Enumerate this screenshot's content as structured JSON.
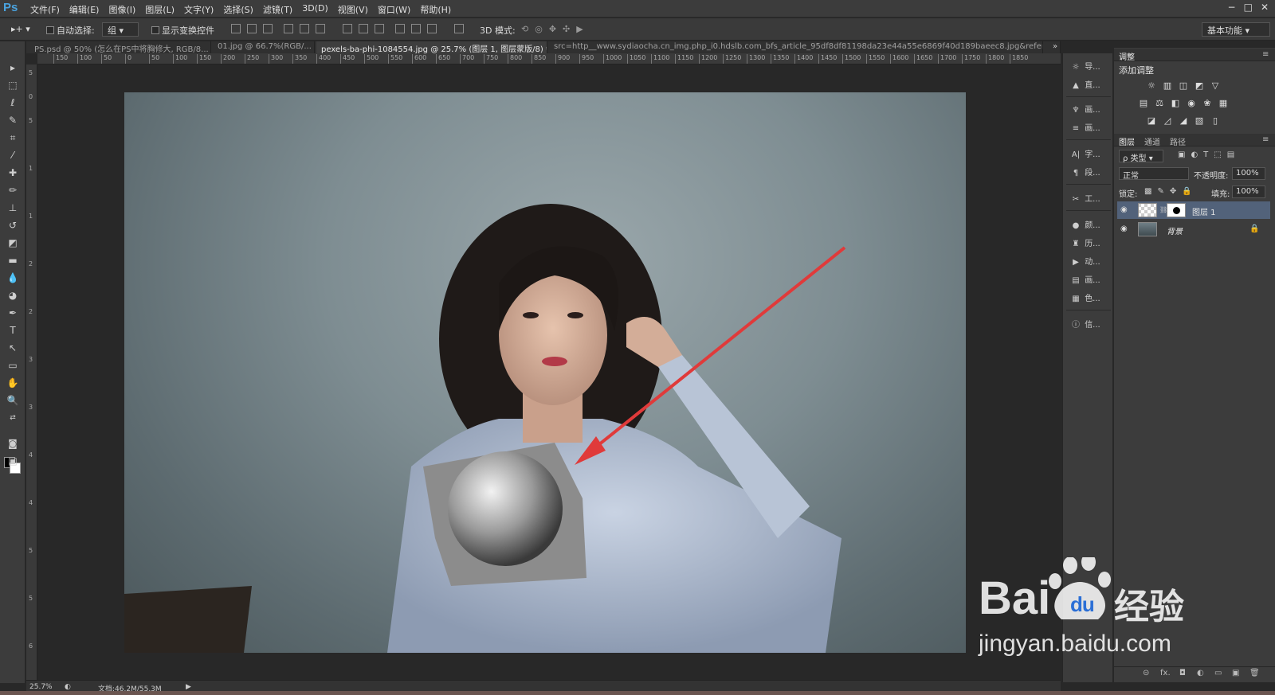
{
  "app": {
    "logo": "Ps",
    "window_controls": [
      "−",
      "□",
      "✕"
    ]
  },
  "menu": [
    "文件(F)",
    "编辑(E)",
    "图像(I)",
    "图层(L)",
    "文字(Y)",
    "选择(S)",
    "滤镜(T)",
    "3D(D)",
    "视图(V)",
    "窗口(W)",
    "帮助(H)"
  ],
  "options": {
    "auto_select_label": "自动选择:",
    "auto_select_value": "组",
    "show_transform_label": "显示变换控件",
    "mode_3d_label": "3D 模式:",
    "workspace": "基本功能"
  },
  "tabs": [
    {
      "label": "PS.psd @ 50% (怎么在PS中将胸修大, RGB/8...",
      "close": "×"
    },
    {
      "label": "01.jpg @ 66.7%(RGB/...",
      "close": "×"
    },
    {
      "label": "pexels-ba-phi-1084554.jpg @ 25.7% (图层 1, 图层蒙版/8) *",
      "close": "×"
    },
    {
      "label": "src=http__www.sydiaocha.cn_img.php_i0.hdslb.com_bfs_article_95df8df81198da23e44a55e6869f40d189baeec8.jpg&refer=http__v"
    }
  ],
  "ruler_h": [
    "150",
    "100",
    "50",
    "0",
    "50",
    "100",
    "150",
    "200",
    "250",
    "300",
    "350",
    "400",
    "450",
    "500",
    "550",
    "600",
    "650",
    "700",
    "750",
    "800",
    "850",
    "900",
    "950",
    "1000",
    "1050",
    "1100",
    "1150",
    "1200",
    "1250",
    "1300",
    "1350",
    "1400",
    "1450",
    "1500",
    "1550",
    "1600",
    "1650",
    "1700",
    "1750",
    "1800",
    "1850"
  ],
  "status": {
    "zoom": "25.7%",
    "doc": "文档:46.2M/55.3M"
  },
  "midcol": [
    {
      "icon": "☼",
      "label": "导..."
    },
    {
      "icon": "▲",
      "label": "直..."
    },
    {
      "icon": "♆",
      "label": "画..."
    },
    {
      "icon": "≡",
      "label": "画..."
    },
    {
      "icon": "A|",
      "label": "字..."
    },
    {
      "icon": "¶",
      "label": "段..."
    },
    {
      "icon": "✂",
      "label": "工..."
    },
    {
      "icon": "●",
      "label": "颜..."
    },
    {
      "icon": "♜",
      "label": "历..."
    },
    {
      "icon": "▶",
      "label": "动..."
    },
    {
      "icon": "▤",
      "label": "画..."
    },
    {
      "icon": "▦",
      "label": "色..."
    },
    {
      "icon": "ⓘ",
      "label": "信..."
    }
  ],
  "adjust_panel": {
    "tab": "调整",
    "title": "添加调整"
  },
  "layers_panel": {
    "tabs": [
      "图层",
      "通道",
      "路径"
    ],
    "filter": "ρ 类型",
    "blend_mode": "正常",
    "opacity_label": "不透明度:",
    "opacity_value": "100%",
    "lock_label": "锁定:",
    "fill_label": "填充:",
    "fill_value": "100%",
    "layers": [
      {
        "name": "图层 1",
        "visible": "👁"
      },
      {
        "name": "背景",
        "visible": "👁"
      }
    ],
    "footer": [
      "⊝",
      "fx.",
      "◘",
      "◐",
      "▭",
      "▣",
      "🗑"
    ]
  },
  "watermark": {
    "brand": "Bai",
    "brand2": "经验",
    "url": "jingyan.baidu.com"
  }
}
